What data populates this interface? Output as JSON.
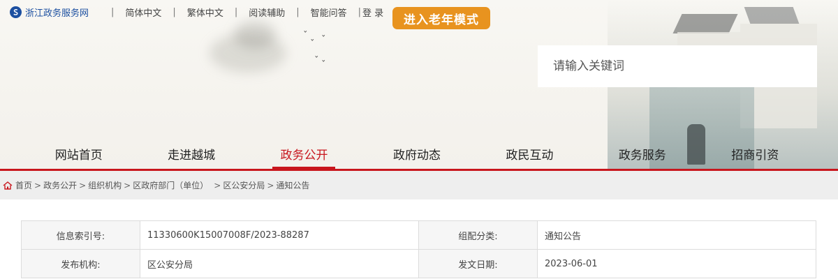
{
  "topbar": {
    "site_name": "浙江政务服务网",
    "links": [
      "简体中文",
      "繁体中文",
      "阅读辅助",
      "智能问答",
      "登 录"
    ],
    "elder_mode_button": "进入老年模式"
  },
  "search": {
    "placeholder": "请输入关键词"
  },
  "nav": {
    "items": [
      "网站首页",
      "走进越城",
      "政务公开",
      "政府动态",
      "政民互动",
      "政务服务",
      "招商引资"
    ],
    "active_index": 2
  },
  "breadcrumb": {
    "items": [
      "首页",
      "政务公开",
      "组织机构",
      "区政府部门（单位）",
      "区公安分局",
      "通知公告"
    ]
  },
  "info_table": {
    "rows": [
      [
        {
          "label": "信息索引号:",
          "value": "11330600K15007008F/2023-88287"
        },
        {
          "label": "组配分类:",
          "value": "通知公告"
        }
      ],
      [
        {
          "label": "发布机构:",
          "value": "区公安分局"
        },
        {
          "label": "发文日期:",
          "value": "2023-06-01"
        }
      ]
    ]
  },
  "colors": {
    "accent": "#c8161d",
    "elder_button": "#e8931f",
    "site_name": "#1c4fa0"
  },
  "icons": {
    "logo": "zhejiang-logo-icon",
    "home": "home-icon"
  }
}
